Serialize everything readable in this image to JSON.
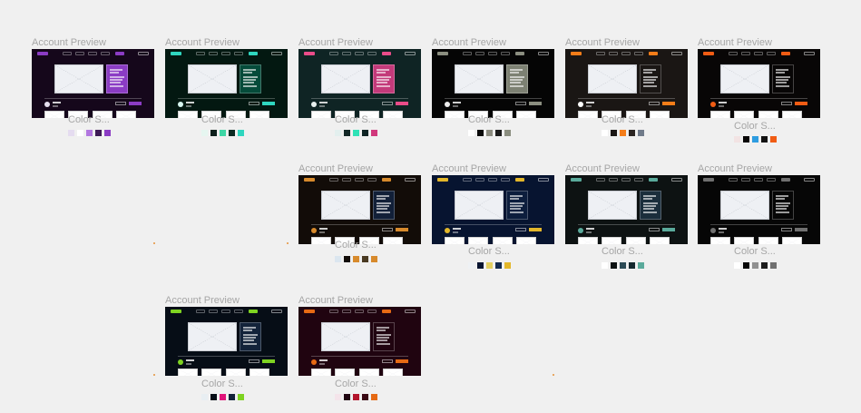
{
  "label": "Account Preview",
  "color_label": "Color S...",
  "cards": [
    {
      "bg": "#15071b",
      "accent": "#8b3cc4",
      "side": "#8b3cc4",
      "avatar": "#e6e0ef",
      "swatches": [
        "#e5dcf0",
        "#ffffff",
        "#b277e0",
        "#3d1a55",
        "#8b3cc4"
      ]
    },
    {
      "bg": "#031811",
      "accent": "#2fd6bf",
      "side": "#054b3a",
      "avatar": "#d8f7f1",
      "swatches": [
        "#e6f6f0",
        "#0d1f1b",
        "#3ed6a5",
        "#0b2a22",
        "#2fd6bf"
      ]
    },
    {
      "bg": "#0f2424",
      "accent": "#ea4c89",
      "side": "#c33a7a",
      "avatar": "#e8f0ef",
      "swatches": [
        "#e3efee",
        "#132827",
        "#2fe2b6",
        "#0f2424",
        "#d0387c"
      ]
    },
    {
      "bg": "#050505",
      "accent": "#8b8e80",
      "side": "#7d8173",
      "avatar": "#ededed",
      "swatches": [
        "#ffffff",
        "#0a0a0a",
        "#8c8c80",
        "#1a1a1a",
        "#8b8e80"
      ]
    },
    {
      "bg": "#1a1614",
      "accent": "#f47d19",
      "side": "#1a1614",
      "avatar": "#ffffff",
      "swatches": [
        "#ffffff",
        "#1a1614",
        "#f47d19",
        "#2b2522",
        "#707b8a"
      ]
    },
    {
      "bg": "#080606",
      "accent": "#f05c14",
      "side": "#080606",
      "avatar": "#f05c14",
      "swatches": [
        "#f2e3e3",
        "#080606",
        "#2e9ce0",
        "#121212",
        "#f05c14"
      ]
    },
    {
      "bg": "#120c08",
      "accent": "#d78a2c",
      "side": "#122038",
      "avatar": "#d78a2c",
      "swatches": [
        "#dbe6ef",
        "#120c08",
        "#d78a2c",
        "#4a3a22",
        "#d78a2c"
      ]
    },
    {
      "bg": "#071430",
      "accent": "#e3b72a",
      "side": "#0d1e3d",
      "avatar": "#e3b72a",
      "swatches": [
        "#eef1f4",
        "#071430",
        "#e3cf62",
        "#132a4f",
        "#e3b72a"
      ]
    },
    {
      "bg": "#0d1212",
      "accent": "#5aaa9b",
      "side": "#1b2e3c",
      "avatar": "#5aaa9b",
      "swatches": [
        "#ffffff",
        "#0d1212",
        "#2c4a55",
        "#15282e",
        "#5aaa9b"
      ]
    },
    {
      "bg": "#060606",
      "accent": "#707070",
      "side": "#060606",
      "avatar": "#707070",
      "swatches": [
        "#ffffff",
        "#060606",
        "#909090",
        "#1c1c1c",
        "#707070"
      ]
    },
    {
      "bg": "#060d16",
      "accent": "#7ed321",
      "side": "#13233a",
      "avatar": "#7ed321",
      "swatches": [
        "#e8eef2",
        "#060d16",
        "#e0147a",
        "#13233a",
        "#7ed321"
      ]
    },
    {
      "bg": "#200410",
      "accent": "#e66a14",
      "side": "#200410",
      "avatar": "#e66a14",
      "swatches": [
        "#f4e4ea",
        "#200410",
        "#b3152c",
        "#3a0814",
        "#e66a14"
      ]
    }
  ]
}
